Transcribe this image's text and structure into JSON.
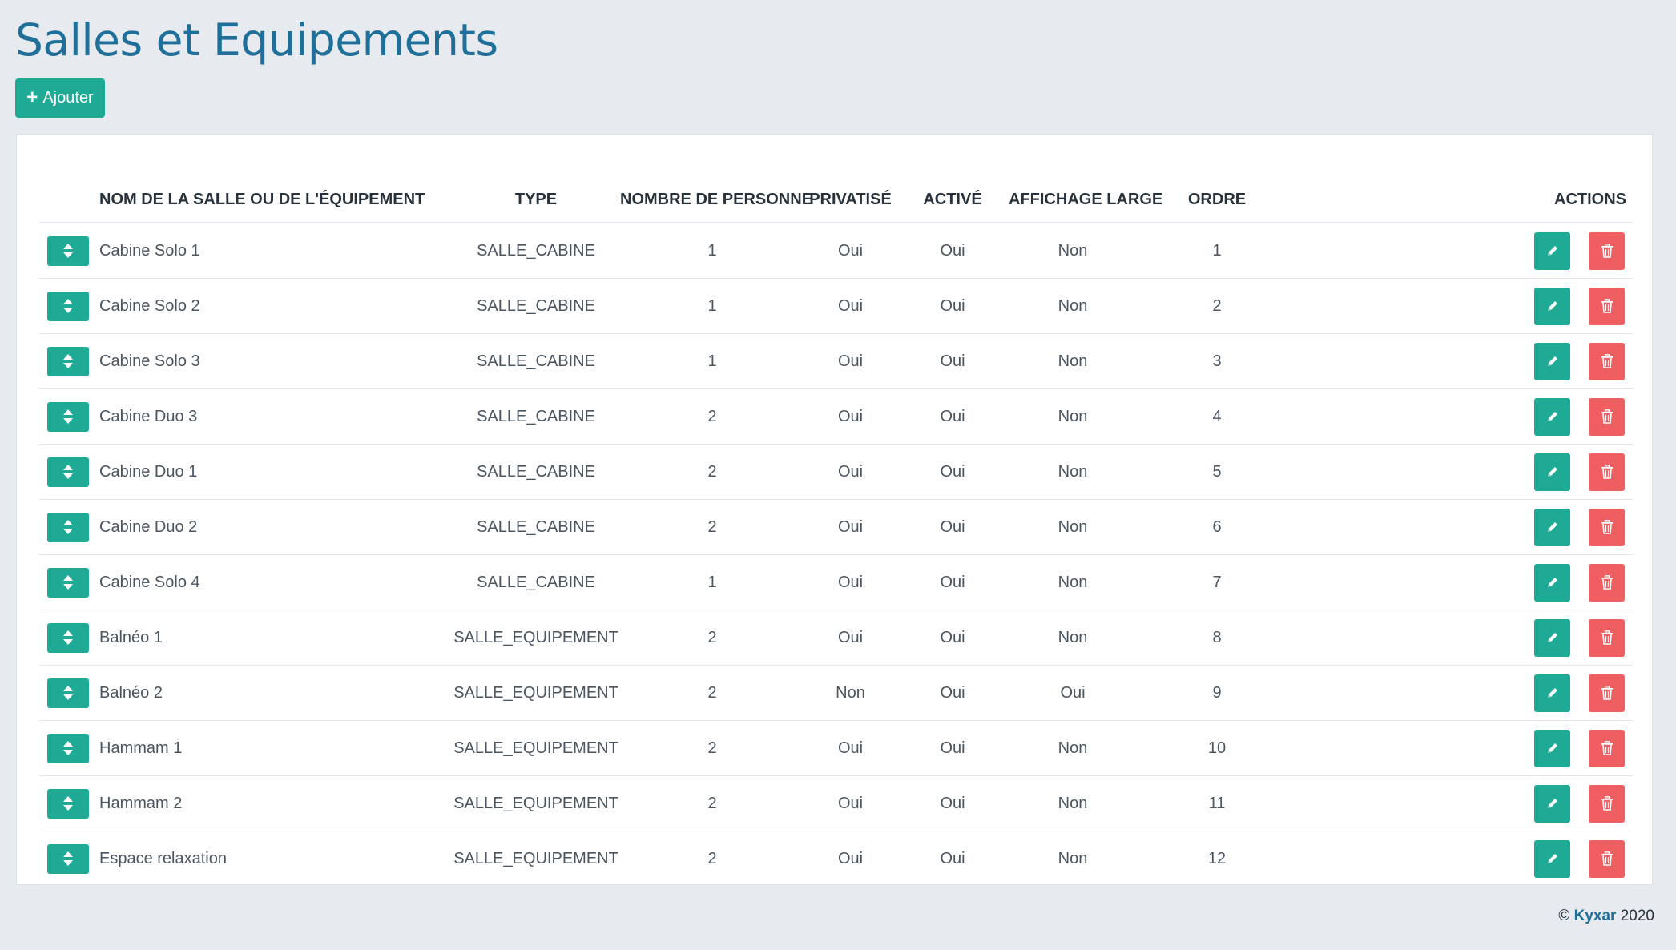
{
  "page": {
    "title": "Salles et Equipements",
    "add_label": "Ajouter"
  },
  "table": {
    "columns": [
      "",
      "NOM DE LA SALLE OU DE L'ÉQUIPEMENT",
      "TYPE",
      "NOMBRE DE PERSONNE",
      "PRIVATISÉ",
      "ACTIVÉ",
      "AFFICHAGE LARGE",
      "ORDRE",
      "ACTIONS"
    ],
    "rows": [
      {
        "name": "Cabine Solo 1",
        "type": "SALLE_CABINE",
        "persons": "1",
        "privatise": "Oui",
        "active": "Oui",
        "affichage_large": "Non",
        "ordre": "1"
      },
      {
        "name": "Cabine Solo 2",
        "type": "SALLE_CABINE",
        "persons": "1",
        "privatise": "Oui",
        "active": "Oui",
        "affichage_large": "Non",
        "ordre": "2"
      },
      {
        "name": "Cabine Solo 3",
        "type": "SALLE_CABINE",
        "persons": "1",
        "privatise": "Oui",
        "active": "Oui",
        "affichage_large": "Non",
        "ordre": "3"
      },
      {
        "name": "Cabine Duo 3",
        "type": "SALLE_CABINE",
        "persons": "2",
        "privatise": "Oui",
        "active": "Oui",
        "affichage_large": "Non",
        "ordre": "4"
      },
      {
        "name": "Cabine Duo 1",
        "type": "SALLE_CABINE",
        "persons": "2",
        "privatise": "Oui",
        "active": "Oui",
        "affichage_large": "Non",
        "ordre": "5"
      },
      {
        "name": "Cabine Duo 2",
        "type": "SALLE_CABINE",
        "persons": "2",
        "privatise": "Oui",
        "active": "Oui",
        "affichage_large": "Non",
        "ordre": "6"
      },
      {
        "name": "Cabine Solo 4",
        "type": "SALLE_CABINE",
        "persons": "1",
        "privatise": "Oui",
        "active": "Oui",
        "affichage_large": "Non",
        "ordre": "7"
      },
      {
        "name": "Balnéo 1",
        "type": "SALLE_EQUIPEMENT",
        "persons": "2",
        "privatise": "Oui",
        "active": "Oui",
        "affichage_large": "Non",
        "ordre": "8"
      },
      {
        "name": "Balnéo 2",
        "type": "SALLE_EQUIPEMENT",
        "persons": "2",
        "privatise": "Non",
        "active": "Oui",
        "affichage_large": "Oui",
        "ordre": "9"
      },
      {
        "name": "Hammam 1",
        "type": "SALLE_EQUIPEMENT",
        "persons": "2",
        "privatise": "Oui",
        "active": "Oui",
        "affichage_large": "Non",
        "ordre": "10"
      },
      {
        "name": "Hammam 2",
        "type": "SALLE_EQUIPEMENT",
        "persons": "2",
        "privatise": "Oui",
        "active": "Oui",
        "affichage_large": "Non",
        "ordre": "11"
      },
      {
        "name": "Espace relaxation",
        "type": "SALLE_EQUIPEMENT",
        "persons": "2",
        "privatise": "Oui",
        "active": "Oui",
        "affichage_large": "Non",
        "ordre": "12"
      }
    ]
  },
  "footer": {
    "copyright": "©",
    "brand": "Kyxar",
    "year": "2020"
  },
  "colors": {
    "accent": "#1faa95",
    "danger": "#ef5f62",
    "title": "#1e6f9a",
    "background": "#e7eaee"
  },
  "icons": {
    "add": "plus-icon",
    "sort": "sort-arrows-icon",
    "edit": "pencil-icon",
    "delete": "trash-icon"
  }
}
